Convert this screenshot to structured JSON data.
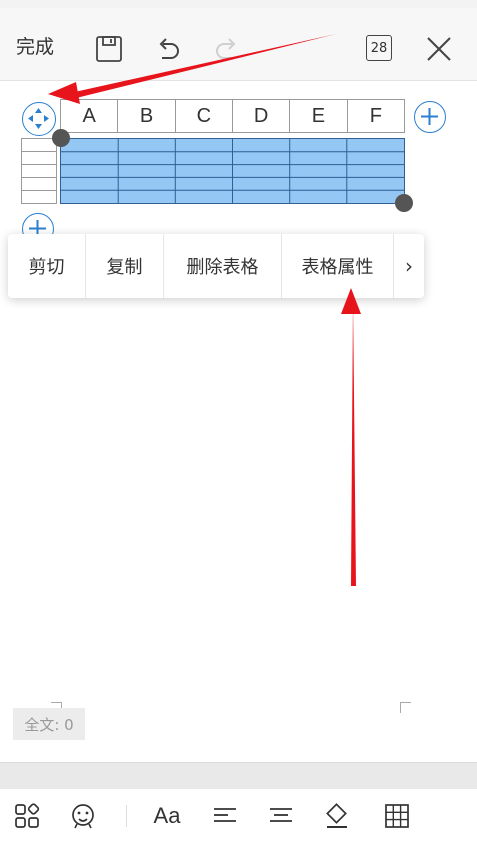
{
  "toolbar": {
    "done_label": "完成",
    "page_count": "28",
    "icons": [
      "save-icon",
      "undo-icon",
      "redo-icon",
      "pages-icon",
      "close-icon"
    ]
  },
  "table": {
    "columns": [
      "A",
      "B",
      "C",
      "D",
      "E",
      "F"
    ],
    "row_count": 5,
    "selection_color": "#94c7f3",
    "accent_color": "#2a7fd0"
  },
  "context_menu": {
    "items": [
      "剪切",
      "复制",
      "删除表格",
      "表格属性"
    ],
    "more": "›"
  },
  "status": {
    "word_count": "全文: 0"
  },
  "bottom_toolbar": {
    "font_label": "Aa",
    "icons": [
      "layout-icon",
      "emoji-icon",
      "font-icon",
      "align-left-icon",
      "align-center-icon",
      "fill-icon",
      "table-icon"
    ]
  },
  "annotation": {
    "arrow_color": "#e8141c"
  }
}
